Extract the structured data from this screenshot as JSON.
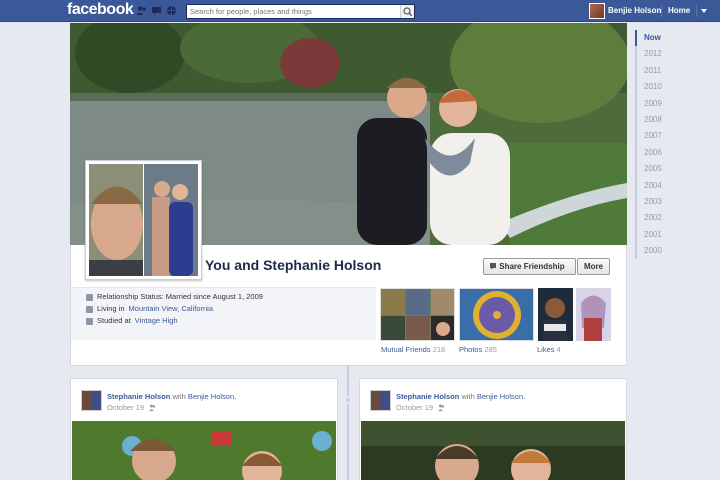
{
  "topbar": {
    "logo": "facebook",
    "search_placeholder": "Search for people, places and things",
    "user_name": "Benjie Holson",
    "home_label": "Home"
  },
  "timeline_years": [
    "Now",
    "2012",
    "2011",
    "2010",
    "2009",
    "2008",
    "2007",
    "2006",
    "2005",
    "2004",
    "2003",
    "2002",
    "2001",
    "2000"
  ],
  "profile": {
    "title": "You and Stephanie Holson",
    "share_button": "Share Friendship",
    "more_button": "More",
    "about": {
      "relationship": "Relationship Status: Married since August 1, 2009",
      "living_prefix": "Living in",
      "living_place": "Mountain View, California",
      "studied_prefix": "Studied at",
      "studied_place": "Vintage High"
    },
    "tiles": {
      "mutual_label": "Mutual Friends",
      "mutual_count": "218",
      "photos_label": "Photos",
      "photos_count": "285",
      "likes_label": "Likes",
      "likes_count": "4"
    }
  },
  "posts": [
    {
      "name": "Stephanie Holson",
      "with": "with",
      "with_name": "Benjie Holson.",
      "date": "October 19"
    },
    {
      "name": "Stephanie Holson",
      "with": "with",
      "with_name": "Benjie Holson.",
      "date": "October 19"
    }
  ],
  "colors": {
    "brand": "#3b5998",
    "page_bg": "#e6e9f0"
  }
}
